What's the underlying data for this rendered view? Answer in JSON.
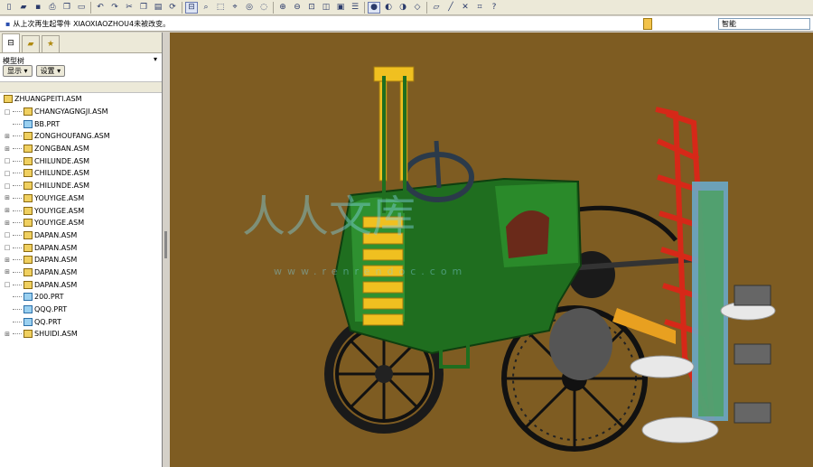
{
  "toolbar": {
    "icons": [
      "new-icon",
      "open-icon",
      "save-icon",
      "print-icon",
      "copy-icon",
      "window-icon",
      "undo-icon",
      "redo-icon",
      "cut-icon",
      "copy-icon",
      "paste-icon",
      "regen-icon",
      "model-tree-icon",
      "find-icon",
      "select-icon",
      "measure-icon",
      "view-icon",
      "repaint-icon",
      "zoom-in-icon",
      "zoom-out-icon",
      "refit-icon",
      "orient-icon",
      "saved-views-icon",
      "layers-icon",
      "shade-icon",
      "hidden-line-icon",
      "no-hidden-icon",
      "wireframe-icon",
      "datum-plane-icon",
      "datum-axis-icon",
      "datum-point-icon",
      "coord-sys-icon",
      "help-icon"
    ]
  },
  "message": {
    "text": "从上次再生起零件 XIAOXIAOZHOU4未被改变。",
    "filter_value": "智能"
  },
  "sidebar": {
    "panel_title": "模型树",
    "menu_glyph": "▾",
    "show_button": "显示 ▾",
    "settings_button": "设置 ▾",
    "tree": [
      {
        "label": "ZHUANGPEITI.ASM",
        "type": "asm",
        "indent": 0,
        "expander": ""
      },
      {
        "label": "CHANGYAGNGJI.ASM",
        "type": "asm",
        "indent": 1,
        "expander": "□"
      },
      {
        "label": "BB.PRT",
        "type": "prt",
        "indent": 1,
        "expander": ""
      },
      {
        "label": "ZONGHOUFANG.ASM",
        "type": "asm",
        "indent": 1,
        "expander": "⊞"
      },
      {
        "label": "ZONGBAN.ASM",
        "type": "asm",
        "indent": 1,
        "expander": "⊞"
      },
      {
        "label": "CHILUNDE.ASM",
        "type": "asm",
        "indent": 1,
        "expander": "□"
      },
      {
        "label": "CHILUNDE.ASM",
        "type": "asm",
        "indent": 1,
        "expander": "□"
      },
      {
        "label": "CHILUNDE.ASM",
        "type": "asm",
        "indent": 1,
        "expander": "□"
      },
      {
        "label": "YOUYIGE.ASM",
        "type": "asm",
        "indent": 1,
        "expander": "⊞"
      },
      {
        "label": "YOUYIGE.ASM",
        "type": "asm",
        "indent": 1,
        "expander": "⊞"
      },
      {
        "label": "YOUYIGE.ASM",
        "type": "asm",
        "indent": 1,
        "expander": "⊞"
      },
      {
        "label": "DAPAN.ASM",
        "type": "asm",
        "indent": 1,
        "expander": "□"
      },
      {
        "label": "DAPAN.ASM",
        "type": "asm",
        "indent": 1,
        "expander": "□"
      },
      {
        "label": "DAPAN.ASM",
        "type": "asm",
        "indent": 1,
        "expander": "⊞"
      },
      {
        "label": "DAPAN.ASM",
        "type": "asm",
        "indent": 1,
        "expander": "⊞"
      },
      {
        "label": "DAPAN.ASM",
        "type": "asm",
        "indent": 1,
        "expander": "□"
      },
      {
        "label": "200.PRT",
        "type": "prt",
        "indent": 1,
        "expander": ""
      },
      {
        "label": "QQQ.PRT",
        "type": "prt",
        "indent": 1,
        "expander": ""
      },
      {
        "label": "QQ.PRT",
        "type": "prt",
        "indent": 1,
        "expander": ""
      },
      {
        "label": "SHUIDI.ASM",
        "type": "asm",
        "indent": 1,
        "expander": "⊞"
      }
    ]
  },
  "viewport": {
    "background": "#7e5c22",
    "watermark": "人人文库",
    "watermark_url": "www.renrendoc.com"
  }
}
